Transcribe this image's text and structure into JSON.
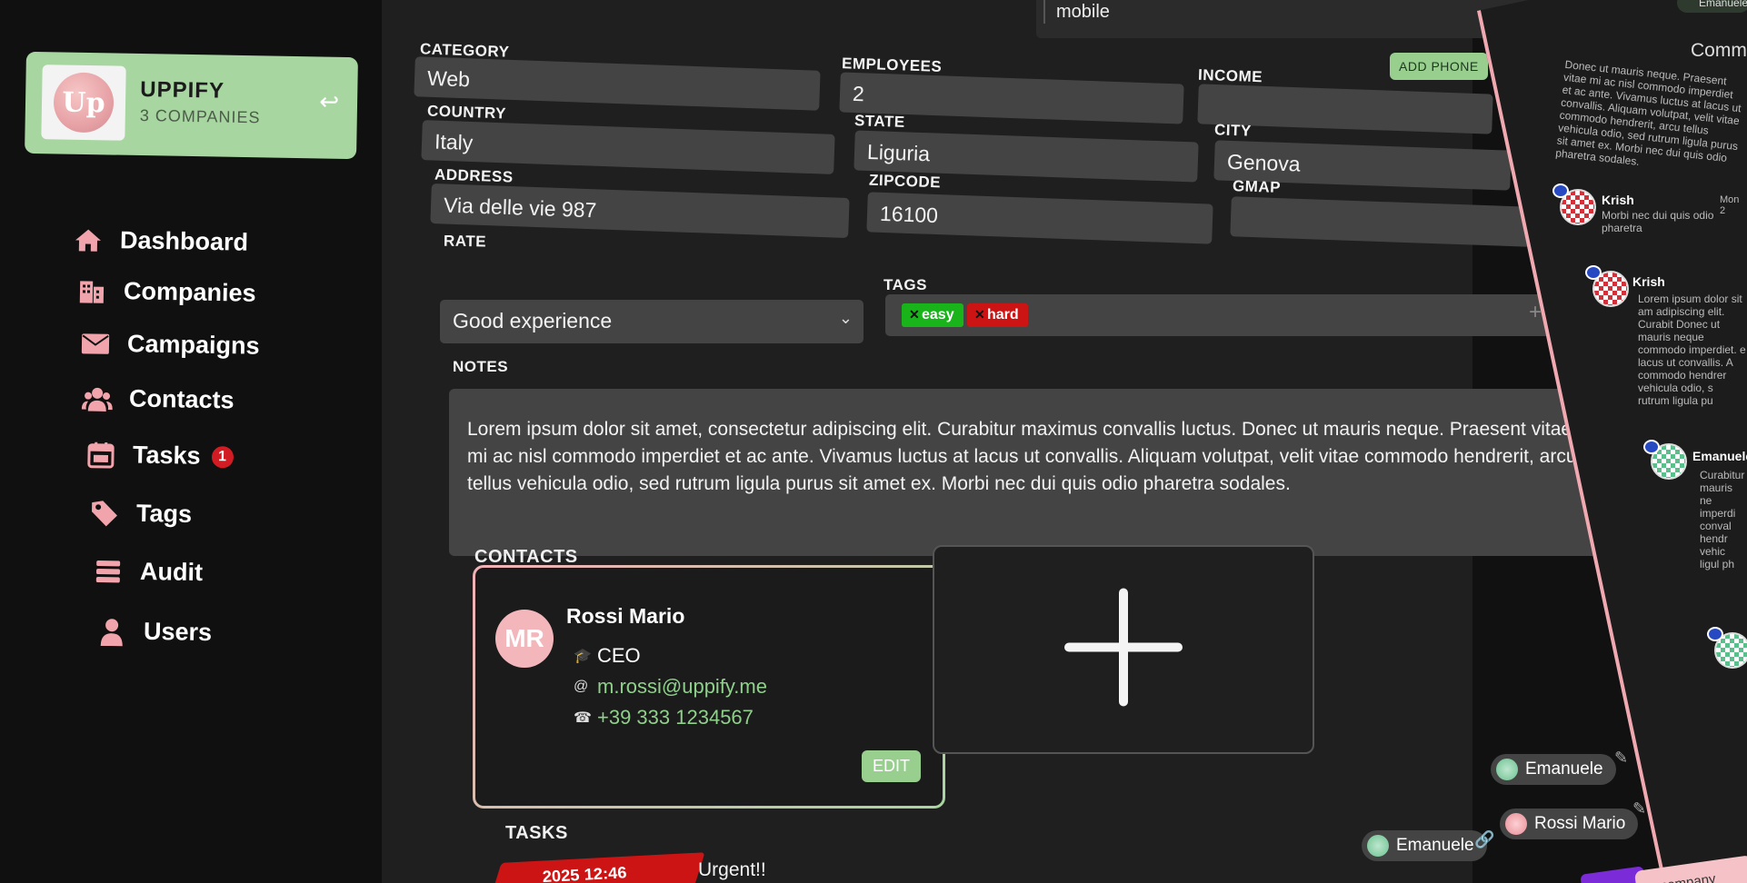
{
  "brand": {
    "logo_text": "Up",
    "name": "UPPIFY",
    "subtitle": "3 COMPANIES"
  },
  "nav": [
    {
      "label": "Dashboard",
      "icon": "home-icon"
    },
    {
      "label": "Companies",
      "icon": "building-icon"
    },
    {
      "label": "Campaigns",
      "icon": "envelope-icon"
    },
    {
      "label": "Contacts",
      "icon": "users-icon"
    },
    {
      "label": "Tasks",
      "icon": "calendar-icon",
      "badge": "1"
    },
    {
      "label": "Tags",
      "icon": "tag-icon"
    },
    {
      "label": "Audit",
      "icon": "database-icon"
    },
    {
      "label": "Users",
      "icon": "user-icon"
    }
  ],
  "phone_row": {
    "type": "mobile"
  },
  "add_phone_label": "ADD PHONE",
  "form": {
    "category": {
      "label": "CATEGORY",
      "value": "Web"
    },
    "employees": {
      "label": "EMPLOYEES",
      "value": "2"
    },
    "income": {
      "label": "INCOME",
      "value": ""
    },
    "country": {
      "label": "COUNTRY",
      "value": "Italy"
    },
    "state": {
      "label": "STATE",
      "value": "Liguria"
    },
    "city": {
      "label": "CITY",
      "value": "Genova"
    },
    "address": {
      "label": "ADDRESS",
      "value": "Via delle vie 987"
    },
    "zipcode": {
      "label": "ZIPCODE",
      "value": "16100"
    },
    "gmap": {
      "label": "GMAP",
      "value": ""
    },
    "rate": {
      "label": "RATE",
      "value": "Good experience"
    },
    "tags": {
      "label": "TAGS",
      "items": [
        "easy",
        "hard"
      ]
    },
    "notes": {
      "label": "NOTES",
      "value": "Lorem ipsum dolor sit amet, consectetur adipiscing elit. Curabitur maximus convallis luctus. Donec ut mauris neque. Praesent vitae mi ac nisl commodo imperdiet et ac ante. Vivamus luctus at lacus ut convallis. Aliquam volutpat, velit vitae commodo hendrerit, arcu tellus vehicula odio, sed rutrum ligula purus sit amet ex. Morbi nec dui quis odio pharetra sodales."
    }
  },
  "contacts": {
    "title": "CONTACTS",
    "items": [
      {
        "initials": "MR",
        "name": "Rossi Mario",
        "role": "CEO",
        "email": "m.rossi@uppify.me",
        "phone": "+39 333 1234567",
        "edit_label": "EDIT"
      }
    ]
  },
  "task_assignments": [
    {
      "users": [
        "Emanuele"
      ]
    },
    {
      "users": [
        "Emanuele",
        "Rossi Mario"
      ]
    }
  ],
  "tasks": {
    "title": "TASKS",
    "items": [
      {
        "date": "2025 12:46",
        "title": "Urgent!!"
      }
    ]
  },
  "comments": {
    "title": "Comme",
    "top_user": "Emanuele",
    "first_text": "Donec ut mauris neque. Praesent vitae mi ac nisl commodo imperdiet et ac ante. Vivamus luctus at lacus ut convallis. Aliquam volutpat, velit vitae commodo hendrerit, arcu tellus vehicula odio, sed rutrum ligula purus sit amet ex. Morbi nec dui quis odio pharetra sodales.",
    "items": [
      {
        "author": "Krish",
        "date": "Mon 2",
        "text": "Morbi nec dui quis odio pharetra"
      },
      {
        "author": "Krish",
        "date": "",
        "text": "Lorem ipsum dolor sit am adipiscing elit. Curabit Donec ut mauris neque commodo imperdiet. e lacus ut convallis. A commodo hendrer vehicula odio, s rutrum ligula pu"
      },
      {
        "author": "Emanuele",
        "date": "",
        "text": "Curabitur mauris ne imperdi conval hendr vehic ligul ph"
      }
    ],
    "bottom_button": "te company"
  }
}
